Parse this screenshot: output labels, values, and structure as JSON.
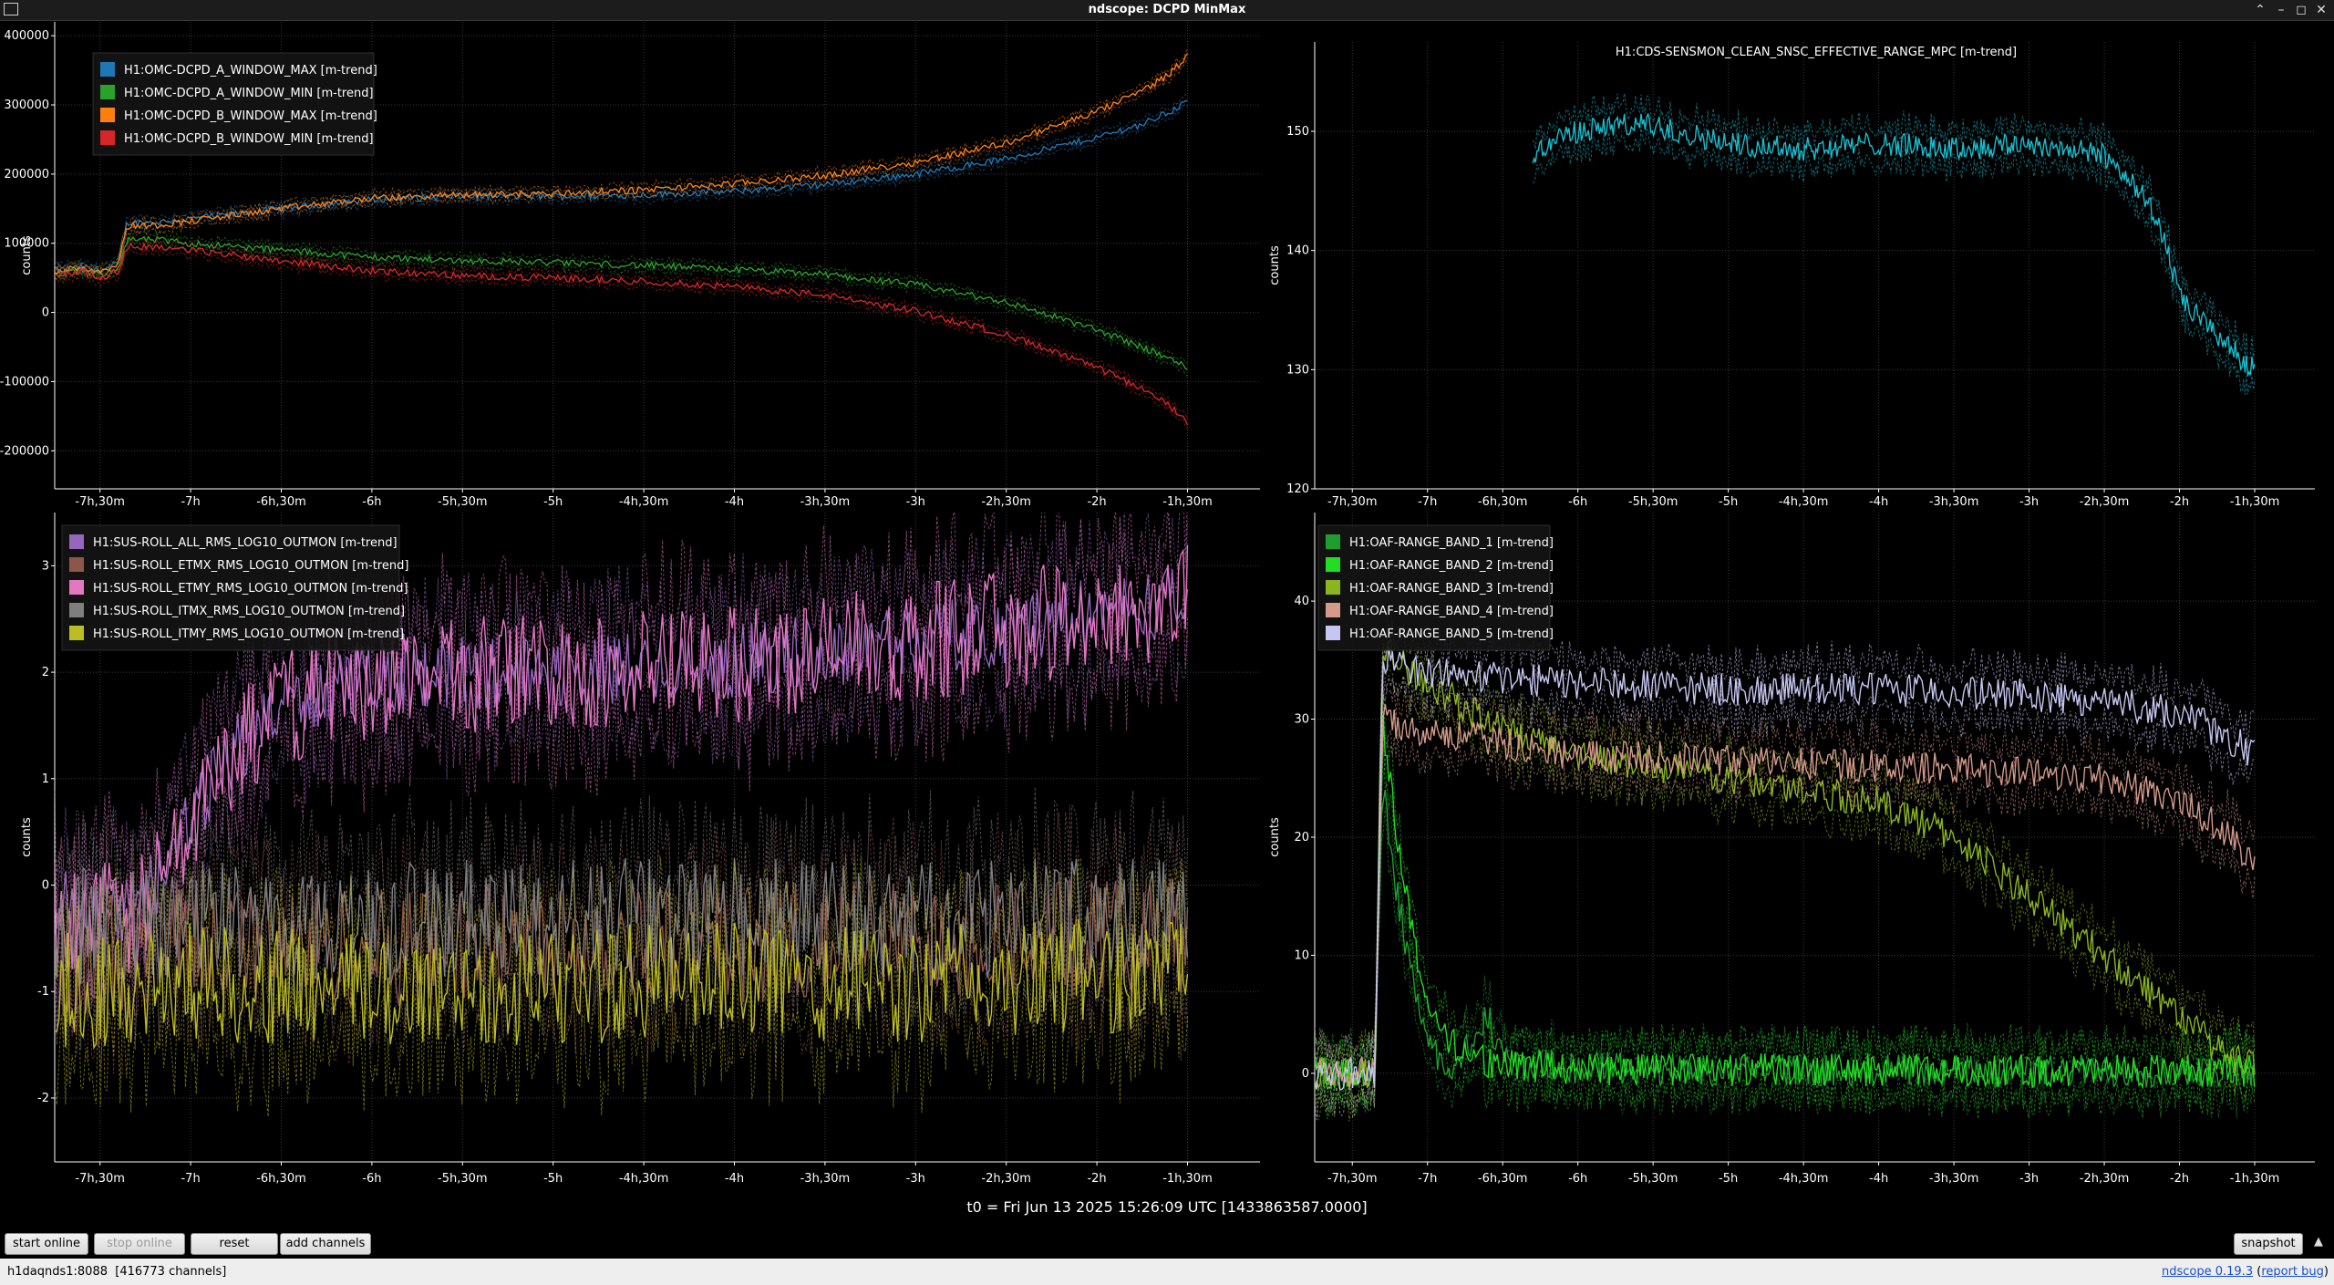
{
  "window": {
    "title": "ndscope: DCPD MinMax"
  },
  "x_axis": {
    "ticks": [
      "-7h,30m",
      "-7h",
      "-6h,30m",
      "-6h",
      "-5h,30m",
      "-5h",
      "-4h,30m",
      "-4h",
      "-3h,30m",
      "-3h",
      "-2h,30m",
      "-2h",
      "-1h,30m"
    ],
    "tick_values_h": [
      -7.5,
      -7,
      -6.5,
      -6,
      -5.5,
      -5,
      -4.5,
      -4,
      -3.5,
      -3,
      -2.5,
      -2,
      -1.5
    ]
  },
  "plots": [
    {
      "ylabel": "counts",
      "ylim": [
        -255000,
        420000
      ],
      "yticks": [
        {
          "v": 400000,
          "l": "400000"
        },
        {
          "v": 300000,
          "l": "300000"
        },
        {
          "v": 200000,
          "l": "200000"
        },
        {
          "v": 100000,
          "l": "100000"
        },
        {
          "v": 0,
          "l": "0"
        },
        {
          "v": -100000,
          "l": "-100000"
        },
        {
          "v": -200000,
          "l": "-200000"
        }
      ],
      "legend": [
        {
          "name": "H1:OMC-DCPD_A_WINDOW_MAX [m-trend]",
          "color": "#1f77b4"
        },
        {
          "name": "H1:OMC-DCPD_A_WINDOW_MIN [m-trend]",
          "color": "#2ca02c"
        },
        {
          "name": "H1:OMC-DCPD_B_WINDOW_MAX [m-trend]",
          "color": "#ff7f0e"
        },
        {
          "name": "H1:OMC-DCPD_B_WINDOW_MIN [m-trend]",
          "color": "#d62728"
        }
      ]
    },
    {
      "title": "H1:CDS-SENSMON_CLEAN_SNSC_EFFECTIVE_RANGE_MPC [m-trend]",
      "ylabel": "counts",
      "ylim": [
        120,
        157.5
      ],
      "yticks": [
        {
          "v": 150,
          "l": "150"
        },
        {
          "v": 140,
          "l": "140"
        },
        {
          "v": 130,
          "l": "130"
        },
        {
          "v": 120,
          "l": "120"
        }
      ],
      "color": "#17becf"
    },
    {
      "ylabel": "counts",
      "ylim": [
        -2.6,
        3.5
      ],
      "yticks": [
        {
          "v": 3,
          "l": "3"
        },
        {
          "v": 2,
          "l": "2"
        },
        {
          "v": 1,
          "l": "1"
        },
        {
          "v": 0,
          "l": "0"
        },
        {
          "v": -1,
          "l": "-1"
        },
        {
          "v": -2,
          "l": "-2"
        }
      ],
      "legend": [
        {
          "name": "H1:SUS-ROLL_ALL_RMS_LOG10_OUTMON [m-trend]",
          "color": "#9467bd"
        },
        {
          "name": "H1:SUS-ROLL_ETMX_RMS_LOG10_OUTMON [m-trend]",
          "color": "#8c564b"
        },
        {
          "name": "H1:SUS-ROLL_ETMY_RMS_LOG10_OUTMON [m-trend]",
          "color": "#e377c2"
        },
        {
          "name": "H1:SUS-ROLL_ITMX_RMS_LOG10_OUTMON [m-trend]",
          "color": "#7f7f7f"
        },
        {
          "name": "H1:SUS-ROLL_ITMY_RMS_LOG10_OUTMON [m-trend]",
          "color": "#bcbd22"
        }
      ]
    },
    {
      "ylabel": "counts",
      "ylim": [
        -7.5,
        47.5
      ],
      "yticks": [
        {
          "v": 40,
          "l": "40"
        },
        {
          "v": 30,
          "l": "30"
        },
        {
          "v": 20,
          "l": "20"
        },
        {
          "v": 10,
          "l": "10"
        },
        {
          "v": 0,
          "l": "0"
        }
      ],
      "legend": [
        {
          "name": "H1:OAF-RANGE_BAND_1 [m-trend]",
          "color": "#1f9e2f"
        },
        {
          "name": "H1:OAF-RANGE_BAND_2 [m-trend]",
          "color": "#22dd22"
        },
        {
          "name": "H1:OAF-RANGE_BAND_3 [m-trend]",
          "color": "#8ab51e"
        },
        {
          "name": "H1:OAF-RANGE_BAND_4 [m-trend]",
          "color": "#d49a8a"
        },
        {
          "name": "H1:OAF-RANGE_BAND_5 [m-trend]",
          "color": "#c6c6f2"
        }
      ]
    }
  ],
  "t0_label": "t0 = Fri Jun 13 2025 15:26:09 UTC [1433863587.0000]",
  "controls": {
    "start_online": "start online",
    "stop_online": "stop online",
    "reset": "reset",
    "add_channels": "add channels",
    "snapshot": "snapshot"
  },
  "status": {
    "server": "h1daqnds1:8088",
    "channels": "[416773 channels]",
    "version_link": "ndscope 0.19.3",
    "report_bug": "report bug"
  },
  "chart_data": [
    {
      "type": "line",
      "x_units": "hours relative to t0",
      "xlim": [
        -7.75,
        -1.1
      ],
      "ylabel": "counts",
      "ylim": [
        -255000,
        420000
      ],
      "series": [
        {
          "name": "H1:OMC-DCPD_A_WINDOW_MAX [m-trend]",
          "x": [
            -7.75,
            -7.6,
            -7.5,
            -7.4,
            -7.35,
            -7.2,
            -7,
            -6.5,
            -6,
            -5.5,
            -5,
            -4.5,
            -4,
            -3.5,
            -3,
            -2.5,
            -2,
            -1.75,
            -1.6,
            -1.5
          ],
          "y": [
            60000,
            65000,
            60000,
            70000,
            130000,
            130000,
            135000,
            150000,
            163000,
            168000,
            168000,
            170000,
            175000,
            185000,
            200000,
            222000,
            253000,
            272000,
            290000,
            305000
          ]
        },
        {
          "name": "H1:OMC-DCPD_A_WINDOW_MIN [m-trend]",
          "x": [
            -7.75,
            -7.6,
            -7.5,
            -7.4,
            -7.35,
            -7.2,
            -7,
            -6.5,
            -6,
            -5.5,
            -5,
            -4.5,
            -4,
            -3.5,
            -3,
            -2.5,
            -2,
            -1.75,
            -1.6,
            -1.5
          ],
          "y": [
            55000,
            60000,
            55000,
            65000,
            105000,
            105000,
            100000,
            90000,
            80000,
            75000,
            72000,
            68000,
            62000,
            55000,
            40000,
            15000,
            -25000,
            -50000,
            -67000,
            -80000
          ]
        },
        {
          "name": "H1:OMC-DCPD_B_WINDOW_MAX [m-trend]",
          "x": [
            -7.75,
            -7.6,
            -7.5,
            -7.4,
            -7.35,
            -7.2,
            -7,
            -6.5,
            -6,
            -5.5,
            -5,
            -4.5,
            -4,
            -3.5,
            -3,
            -2.5,
            -2,
            -1.75,
            -1.6,
            -1.5
          ],
          "y": [
            60000,
            65000,
            60000,
            70000,
            125000,
            126000,
            132000,
            150000,
            165000,
            170000,
            172000,
            177000,
            186000,
            198000,
            217000,
            245000,
            290000,
            320000,
            345000,
            370000
          ]
        },
        {
          "name": "H1:OMC-DCPD_B_WINDOW_MIN [m-trend]",
          "x": [
            -7.75,
            -7.6,
            -7.5,
            -7.4,
            -7.35,
            -7.2,
            -7,
            -6.5,
            -6,
            -5.5,
            -5,
            -4.5,
            -4,
            -3.5,
            -3,
            -2.5,
            -2,
            -1.75,
            -1.6,
            -1.5
          ],
          "y": [
            55000,
            60000,
            50000,
            60000,
            95000,
            95000,
            90000,
            75000,
            60000,
            53000,
            50000,
            45000,
            37000,
            25000,
            2000,
            -32000,
            -80000,
            -110000,
            -135000,
            -160000
          ]
        }
      ]
    },
    {
      "type": "line",
      "title": "H1:CDS-SENSMON_CLEAN_SNSC_EFFECTIVE_RANGE_MPC [m-trend]",
      "ylabel": "counts",
      "xlim": [
        -7.75,
        -1.1
      ],
      "ylim": [
        120,
        157.5
      ],
      "series": [
        {
          "name": "H1:CDS-SENSMON_CLEAN_SNSC_EFFECTIVE_RANGE_MPC [m-trend]",
          "x": [
            -6.3,
            -6.2,
            -6,
            -5.75,
            -5.5,
            -5,
            -4.5,
            -4,
            -3.5,
            -3,
            -2.75,
            -2.5,
            -2.25,
            -2.1,
            -2,
            -1.85,
            -1.75,
            -1.6,
            -1.5
          ],
          "y": [
            148,
            149,
            150,
            150.5,
            150.5,
            149,
            148.5,
            149,
            148.5,
            149,
            148.5,
            148,
            145,
            141,
            136,
            134,
            133,
            131,
            130
          ]
        }
      ]
    },
    {
      "type": "line",
      "ylabel": "counts",
      "xlim": [
        -7.75,
        -1.1
      ],
      "ylim": [
        -2.6,
        3.5
      ],
      "series": [
        {
          "name": "H1:SUS-ROLL_ALL_RMS_LOG10_OUTMON [m-trend]",
          "x": [
            -7.75,
            -7.3,
            -7,
            -6.75,
            -6.5,
            -6,
            -5.5,
            -5,
            -4.5,
            -4,
            -3.5,
            -3,
            -2.5,
            -2,
            -1.75,
            -1.5
          ],
          "y": [
            -0.2,
            -0.3,
            0.6,
            1.3,
            1.7,
            1.95,
            2.0,
            2.01,
            2.03,
            2.1,
            2.2,
            2.3,
            2.42,
            2.55,
            2.62,
            2.7
          ]
        },
        {
          "name": "H1:SUS-ROLL_ETMX_RMS_LOG10_OUTMON [m-trend]",
          "x": [
            -7.75,
            -7,
            -6,
            -5,
            -4,
            -3,
            -2,
            -1.5
          ],
          "y": [
            -0.7,
            -0.5,
            -0.6,
            -0.5,
            -0.55,
            -0.5,
            -0.5,
            -0.45
          ]
        },
        {
          "name": "H1:SUS-ROLL_ETMY_RMS_LOG10_OUTMON [m-trend]",
          "x": [
            -7.75,
            -7.3,
            -7,
            -6.75,
            -6.5,
            -6,
            -5.5,
            -5,
            -4.5,
            -4,
            -3.5,
            -3,
            -2.5,
            -2,
            -1.75,
            -1.5
          ],
          "y": [
            -0.25,
            -0.35,
            0.55,
            1.28,
            1.68,
            1.93,
            1.98,
            2.0,
            2.02,
            2.08,
            2.18,
            2.28,
            2.4,
            2.53,
            2.6,
            2.68
          ]
        },
        {
          "name": "H1:SUS-ROLL_ITMX_RMS_LOG10_OUTMON [m-trend]",
          "x": [
            -7.75,
            -7,
            -6,
            -5,
            -4,
            -3,
            -2,
            -1.5
          ],
          "y": [
            -0.4,
            -0.3,
            -0.35,
            -0.3,
            -0.3,
            -0.35,
            -0.3,
            -0.3
          ]
        },
        {
          "name": "H1:SUS-ROLL_ITMY_RMS_LOG10_OUTMON [m-trend]",
          "x": [
            -7.75,
            -7,
            -6,
            -5,
            -4,
            -3,
            -2,
            -1.5
          ],
          "y": [
            -1.0,
            -0.9,
            -1.0,
            -0.95,
            -0.9,
            -0.95,
            -0.85,
            -0.8
          ]
        }
      ]
    },
    {
      "type": "line",
      "ylabel": "counts",
      "xlim": [
        -7.75,
        -1.1
      ],
      "ylim": [
        -7.5,
        47.5
      ],
      "series": [
        {
          "name": "H1:OAF-RANGE_BAND_1 [m-trend]",
          "x": [
            -7.75,
            -7.35,
            -7.3,
            -7.2,
            -7.1,
            -7,
            -6.9,
            -6.8,
            -6.6,
            -6.5,
            -6,
            -5,
            -4,
            -3,
            -2,
            -1.5
          ],
          "y": [
            0,
            0,
            25,
            15,
            8,
            3,
            1,
            0.5,
            5,
            1,
            0.5,
            0.3,
            0.3,
            0.2,
            0.2,
            0.2
          ]
        },
        {
          "name": "H1:OAF-RANGE_BAND_2 [m-trend]",
          "x": [
            -7.75,
            -7.35,
            -7.3,
            -7.2,
            -7.1,
            -7,
            -6.9,
            -6.6,
            -6.5,
            -6,
            -5,
            -4,
            -3,
            -2,
            -1.5
          ],
          "y": [
            0,
            0,
            30,
            20,
            12,
            6,
            3,
            1,
            0.7,
            0.4,
            0.3,
            0.3,
            0.2,
            0.2,
            0.2
          ]
        },
        {
          "name": "H1:OAF-RANGE_BAND_3 [m-trend]",
          "x": [
            -7.75,
            -7.35,
            -7.3,
            -7,
            -6.5,
            -6,
            -5.5,
            -5,
            -4.5,
            -4,
            -3.5,
            -3,
            -2.5,
            -2,
            -1.75,
            -1.5
          ],
          "y": [
            0,
            0,
            36,
            33,
            29,
            27,
            26,
            25,
            24,
            23,
            20,
            15,
            10,
            5,
            2,
            0.5
          ]
        },
        {
          "name": "H1:OAF-RANGE_BAND_4 [m-trend]",
          "x": [
            -7.75,
            -7.35,
            -7.3,
            -7,
            -6.5,
            -6,
            -5,
            -4,
            -3,
            -2.5,
            -2,
            -1.75,
            -1.5
          ],
          "y": [
            0,
            0,
            30,
            29,
            28,
            27,
            26.5,
            26,
            25.5,
            25,
            23,
            21,
            18
          ]
        },
        {
          "name": "H1:OAF-RANGE_BAND_5 [m-trend]",
          "x": [
            -7.75,
            -7.35,
            -7.3,
            -7,
            -6.5,
            -6,
            -5,
            -4,
            -3,
            -2.5,
            -2,
            -1.75,
            -1.5
          ],
          "y": [
            0,
            0,
            35,
            34,
            33.5,
            33,
            32.5,
            32.5,
            32,
            31.5,
            30.5,
            29,
            27
          ]
        }
      ]
    }
  ]
}
